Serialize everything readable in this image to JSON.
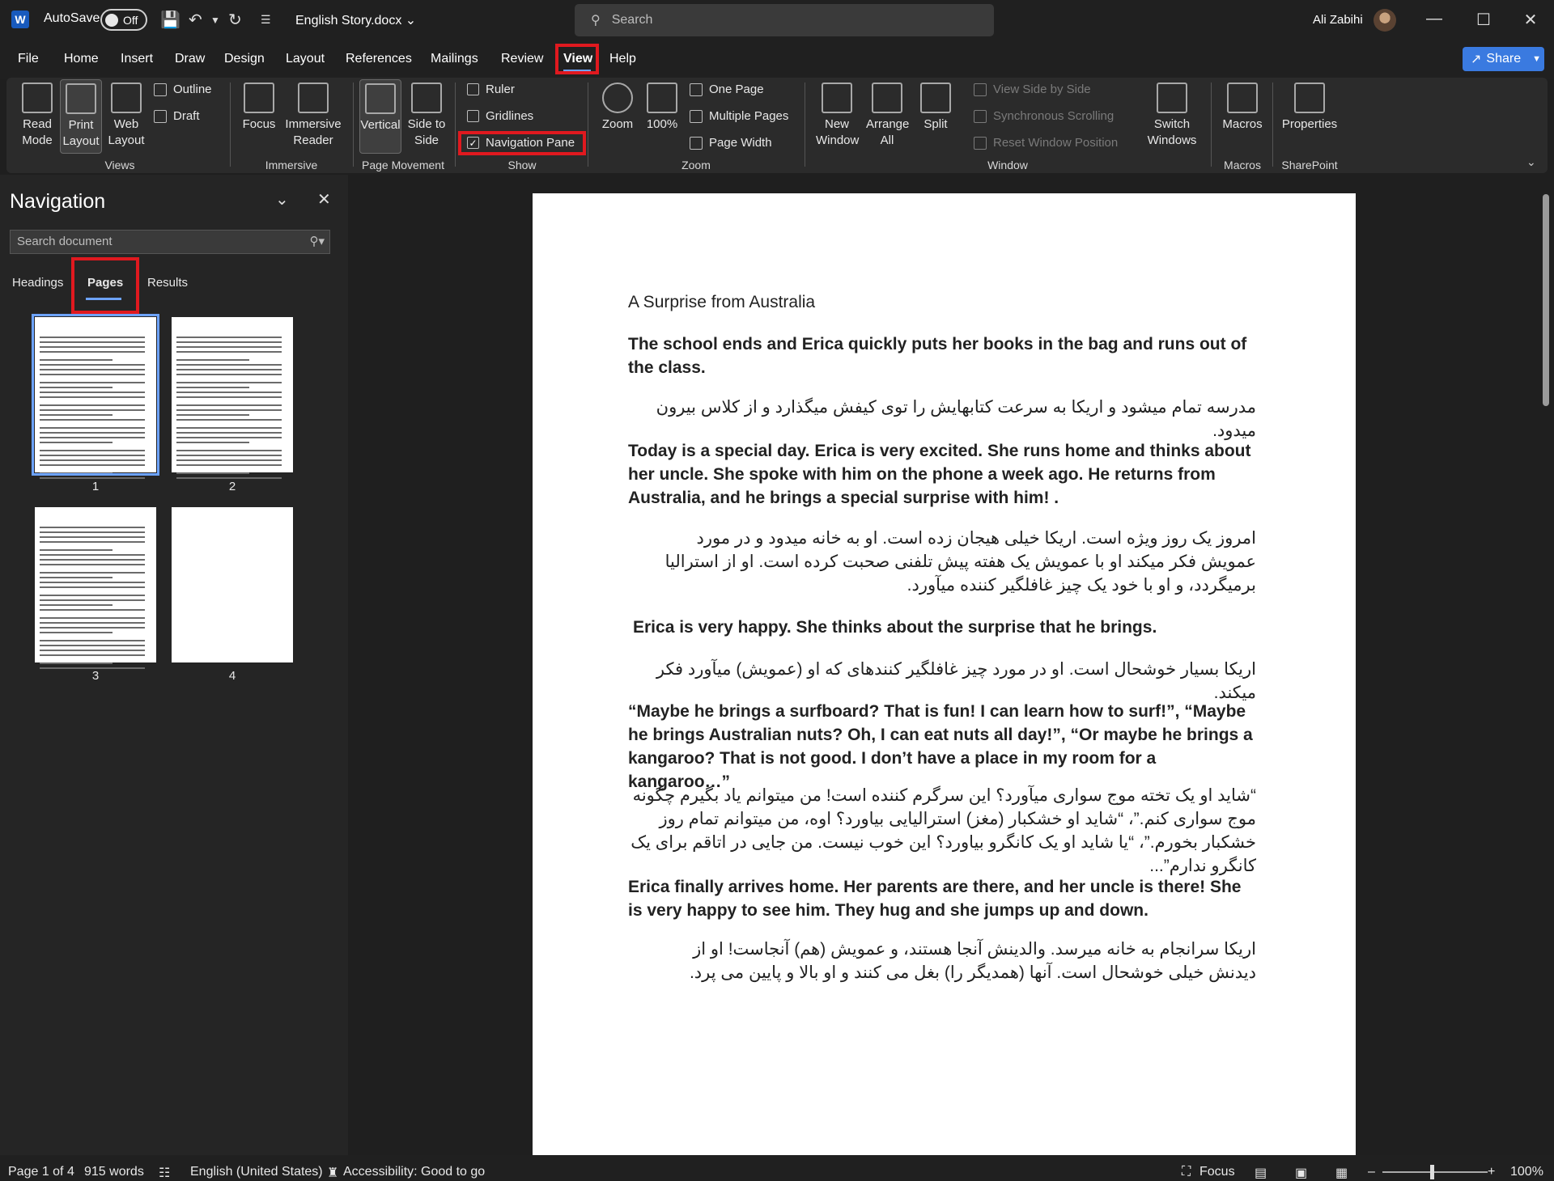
{
  "title_bar": {
    "autosave_label": "AutoSave",
    "autosave_state": "Off",
    "document_name": "English Story.docx",
    "search_placeholder": "Search",
    "user_name": "Ali Zabihi"
  },
  "menu": {
    "items": [
      "File",
      "Home",
      "Insert",
      "Draw",
      "Design",
      "Layout",
      "References",
      "Mailings",
      "Review",
      "View",
      "Help"
    ],
    "active": "View",
    "share_label": "Share"
  },
  "ribbon": {
    "views": {
      "read_mode": "Read Mode",
      "print_layout": "Print Layout",
      "web_layout": "Web Layout",
      "outline": "Outline",
      "draft": "Draft",
      "group": "Views"
    },
    "immersive": {
      "focus": "Focus",
      "immersive_reader": "Immersive Reader",
      "group": "Immersive"
    },
    "page_movement": {
      "vertical": "Vertical",
      "side_to_side": "Side to Side",
      "group": "Page Movement"
    },
    "show": {
      "ruler": "Ruler",
      "gridlines": "Gridlines",
      "navigation_pane": "Navigation Pane",
      "group": "Show"
    },
    "zoom": {
      "zoom": "Zoom",
      "hundred": "100%",
      "one_page": "One Page",
      "multiple_pages": "Multiple Pages",
      "page_width": "Page Width",
      "group": "Zoom"
    },
    "window": {
      "new_window": "New Window",
      "arrange_all": "Arrange All",
      "split": "Split",
      "view_side_by_side": "View Side by Side",
      "synchronous_scrolling": "Synchronous Scrolling",
      "reset_window_position": "Reset Window Position",
      "switch_windows": "Switch Windows",
      "group": "Window"
    },
    "macros": {
      "macros": "Macros",
      "group": "Macros"
    },
    "sharepoint": {
      "properties": "Properties",
      "group": "SharePoint"
    }
  },
  "navigation": {
    "title": "Navigation",
    "search_placeholder": "Search document",
    "tabs": [
      "Headings",
      "Pages",
      "Results"
    ],
    "active_tab": "Pages",
    "pages": [
      "1",
      "2",
      "3",
      "4"
    ]
  },
  "document": {
    "paragraphs": [
      "A Surprise from Australia",
      "The school ends and Erica quickly puts her books in the bag and runs out of the class.",
      "مدرسه تمام میشود و اریکا به سرعت کتابهایش را توی کیفش میگذارد و از کلاس بیرون میدود.",
      "Today is a special day. Erica is very excited. She runs home and thinks about her uncle. She spoke with him on the phone a week ago. He returns from Australia, and he brings a special surprise with him! .",
      "امروز  یک روز ویژه است. اریکا خیلی هیجان زده است. او به خانه میدود و در مورد عمویش فکر میکند او با عمویش یک هفته پیش تلفنی صحبت کرده است. او از استرالیا برمیگردد، و او با خود یک چیز غافلگیر کننده میآورد.",
      "Erica is very happy. She thinks about the surprise that he brings.",
      "اریکا بسیار خوشحال است. او در مورد چیز غافلگیر کنندهای که او (عمویش) میآورد فکر میکند.",
      "“Maybe he brings a surfboard? That is fun! I can learn how to surf!”, “Maybe he brings Australian nuts? Oh, I can eat nuts all day!”, “Or maybe he brings a kangaroo? That is not good. I don’t have a place in my room for a kangaroo…”",
      "“شاید او یک تخته موج سواری میآورد؟ این سرگرم کننده است! من میتوانم یاد بگیرم چگونه موج سواری کنم.”، “شاید او خشکبار (مغز) استرالیایی بیاورد؟ اوه، من میتوانم تمام روز خشکبار بخورم.”، “یا شاید او یک کانگرو بیاورد؟ این خوب نیست. من جایی در اتاقم برای یک کانگرو ندارم”...",
      "Erica finally arrives home. Her parents are there, and her uncle is there! She is very happy to see him. They hug and she jumps up and down.",
      "اریکا سرانجام به خانه میرسد. والدینش آنجا هستند، و عمویش (هم) آنجاست! او از دیدنش خیلی خوشحال است. آنها (همدیگر را) بغل می کنند و او بالا و پایین می پرد."
    ]
  },
  "status": {
    "page": "Page 1 of 4",
    "words": "915 words",
    "language": "English (United States)",
    "accessibility": "Accessibility: Good to go",
    "focus": "Focus",
    "zoom": "100%"
  }
}
